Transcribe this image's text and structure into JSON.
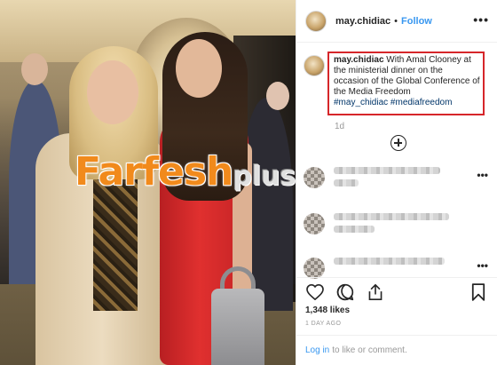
{
  "watermark": {
    "main": "Farfesh",
    "sub": "plus.com",
    "main_color": "#f18a1c"
  },
  "post": {
    "username": "may.chidiac",
    "separator": "•",
    "follow_label": "Follow",
    "more_icon": "more-horizontal-icon",
    "caption": {
      "username": "may.chidiac",
      "text": "With Amal Clooney at the ministerial dinner on the occasion of the Global Conference of the Media Freedom",
      "hashtags": "#may_chidiac #mediafreedom",
      "highlight_color": "#d6262a"
    },
    "caption_age": "1d",
    "load_more_icon": "plus-circle-icon",
    "likes": "1,348 likes",
    "date": "1 DAY AGO",
    "actions": [
      "heart-icon",
      "comment-icon",
      "share-icon"
    ],
    "save_icon": "bookmark-icon",
    "comment_prompt": {
      "link": "Log in",
      "rest": "to like or comment."
    }
  },
  "colors": {
    "link_blue": "#3897f0",
    "hashtag_blue": "#003569",
    "muted_gray": "#999999"
  }
}
